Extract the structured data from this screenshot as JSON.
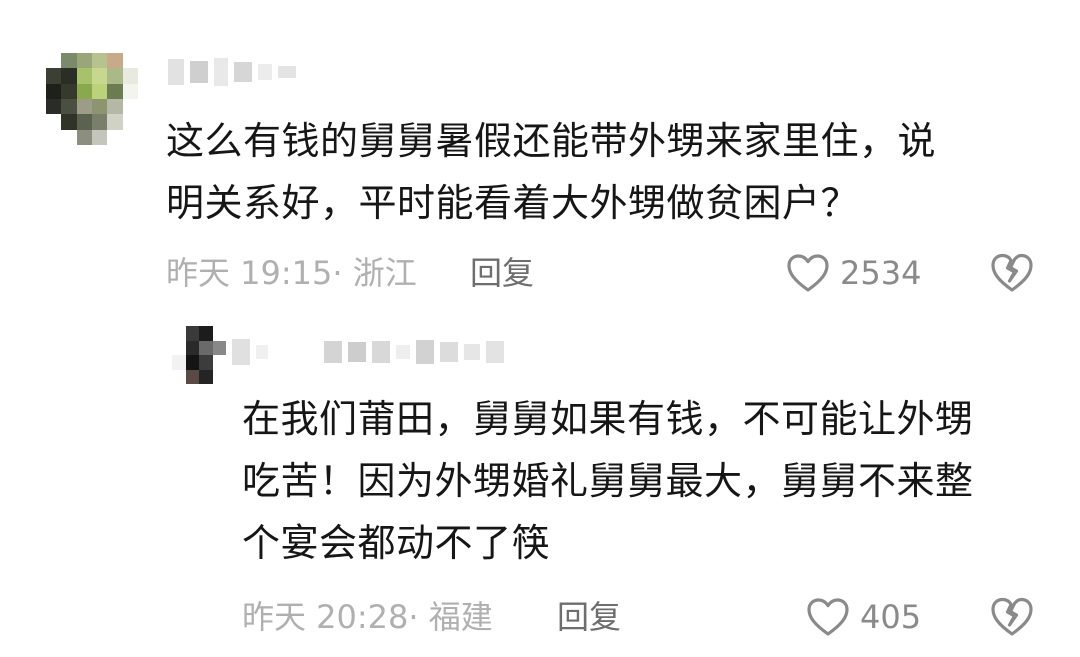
{
  "comments": {
    "main": {
      "text": "这么有钱的舅舅暑假还能带外甥来家里住，说\n明关系好，平时能看着大外甥做贫困户？",
      "meta": "昨天 19:15· 浙江",
      "reply_label": "回复",
      "likes": "2534"
    },
    "reply": {
      "text": "在我们莆田，舅舅如果有钱，不可能让外甥\n吃苦！因为外甥婚礼舅舅最大，舅舅不来整\n个宴会都动不了筷",
      "meta": "昨天 20:28· 福建",
      "reply_label": "回复",
      "likes": "405"
    }
  },
  "icons": {
    "like": "heart-outline-icon",
    "dislike": "broken-heart-icon"
  },
  "colors": {
    "text": "#161616",
    "meta": "#b0b0b0",
    "reply": "#6e6e6e",
    "icon": "#8a8a8a"
  }
}
